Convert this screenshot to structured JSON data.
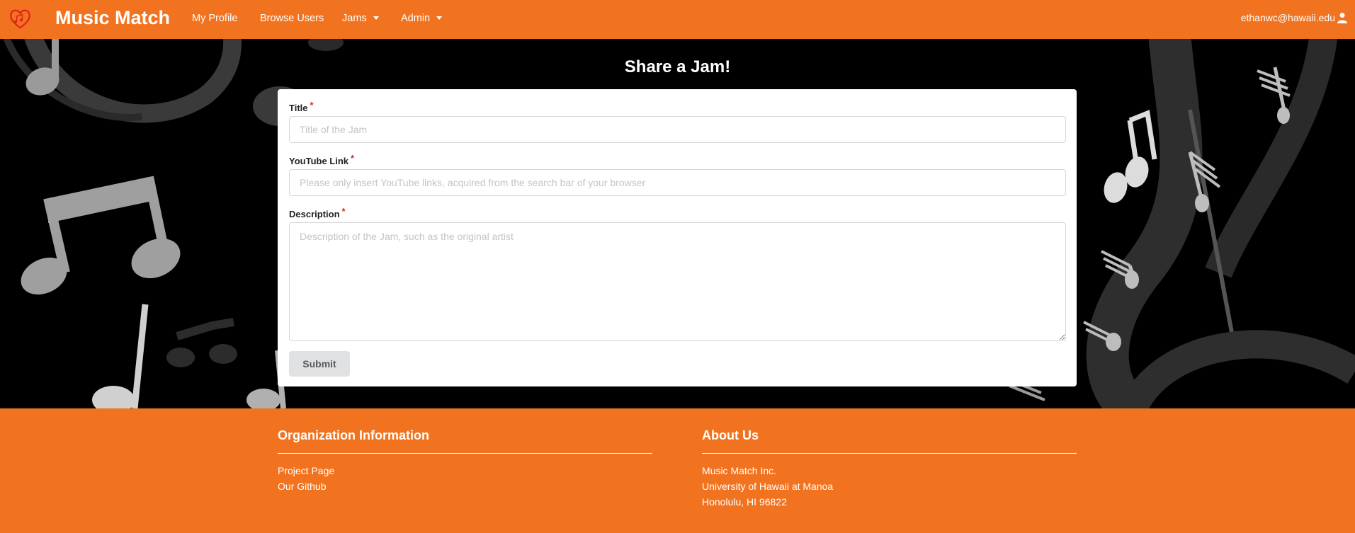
{
  "navbar": {
    "brand": "Music Match",
    "links": {
      "my_profile": "My Profile",
      "browse_users": "Browse Users",
      "jams": "Jams",
      "admin": "Admin"
    },
    "user_email": "ethanwc@hawaii.edu",
    "logo_icon": "heart-music-logo-icon",
    "user_icon": "user-icon"
  },
  "page": {
    "title": "Share a Jam!"
  },
  "form": {
    "title_label": "Title",
    "title_placeholder": "Title of the Jam",
    "youtube_label": "YouTube Link",
    "youtube_placeholder": "Please only insert YouTube links, acquired from the search bar of your browser",
    "description_label": "Description",
    "description_placeholder": "Description of the Jam, such as the original artist",
    "required_mark": "*",
    "submit_label": "Submit"
  },
  "footer": {
    "org": {
      "heading": "Organization Information",
      "links": [
        "Project Page",
        "Our Github"
      ]
    },
    "about": {
      "heading": "About Us",
      "lines": [
        "Music Match Inc.",
        "University of Hawaii at Manoa",
        "Honolulu, HI 96822"
      ]
    }
  },
  "colors": {
    "brand_orange": "#f2731f",
    "required_red": "#db2828",
    "submit_gray": "#e0e1e2"
  }
}
